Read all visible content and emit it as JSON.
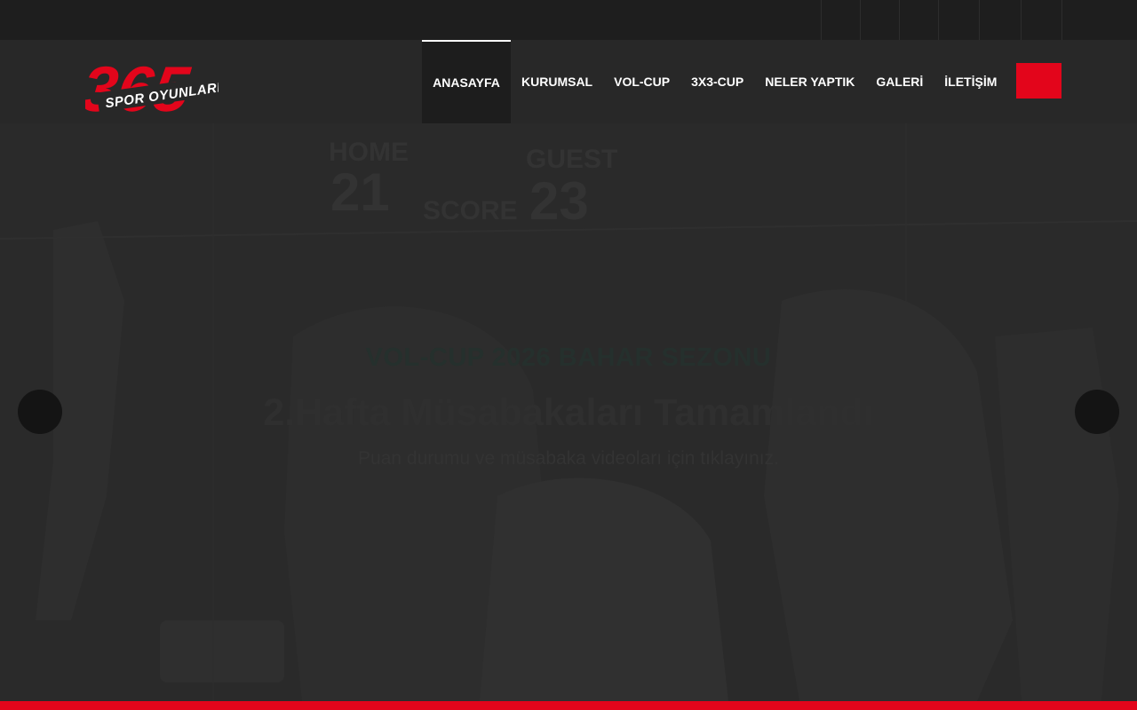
{
  "social": {
    "icons": [
      "facebook-icon",
      "twitter-icon",
      "instagram-icon",
      "youtube-icon",
      "linkedin-icon",
      "whatsapp-icon"
    ],
    "glyph": ""
  },
  "logo": {
    "number": "365",
    "tagline": "SPOR OYUNLARI",
    "brand_color": "#e3051b"
  },
  "nav": {
    "items": [
      {
        "label": "ANASAYFA"
      },
      {
        "label": "KURUMSAL"
      },
      {
        "label": "VOL-CUP"
      },
      {
        "label": "3X3-CUP"
      },
      {
        "label": "NELER YAPTIK"
      },
      {
        "label": "GALERİ"
      },
      {
        "label": "İLETİŞİM"
      }
    ],
    "search_glyph": ""
  },
  "hero": {
    "kicker": "VOL-CUP 2026 BAHAR SEZONU",
    "headline": "2.Hafta Müsabakaları Tamamlandı",
    "subline": "Puan durumu ve müsabaka videoları için tıklayınız.",
    "scoreboard": {
      "home_label": "HOME",
      "home_score": "21",
      "score_label": "SCORE",
      "guest_label": "GUEST",
      "guest_score": "23"
    },
    "prev_glyph": "",
    "next_glyph": ""
  },
  "colors": {
    "accent": "#e3051b",
    "topbar": "#1e1e1e",
    "header": "#282828",
    "hero_overlay": "#2a2a2a"
  }
}
